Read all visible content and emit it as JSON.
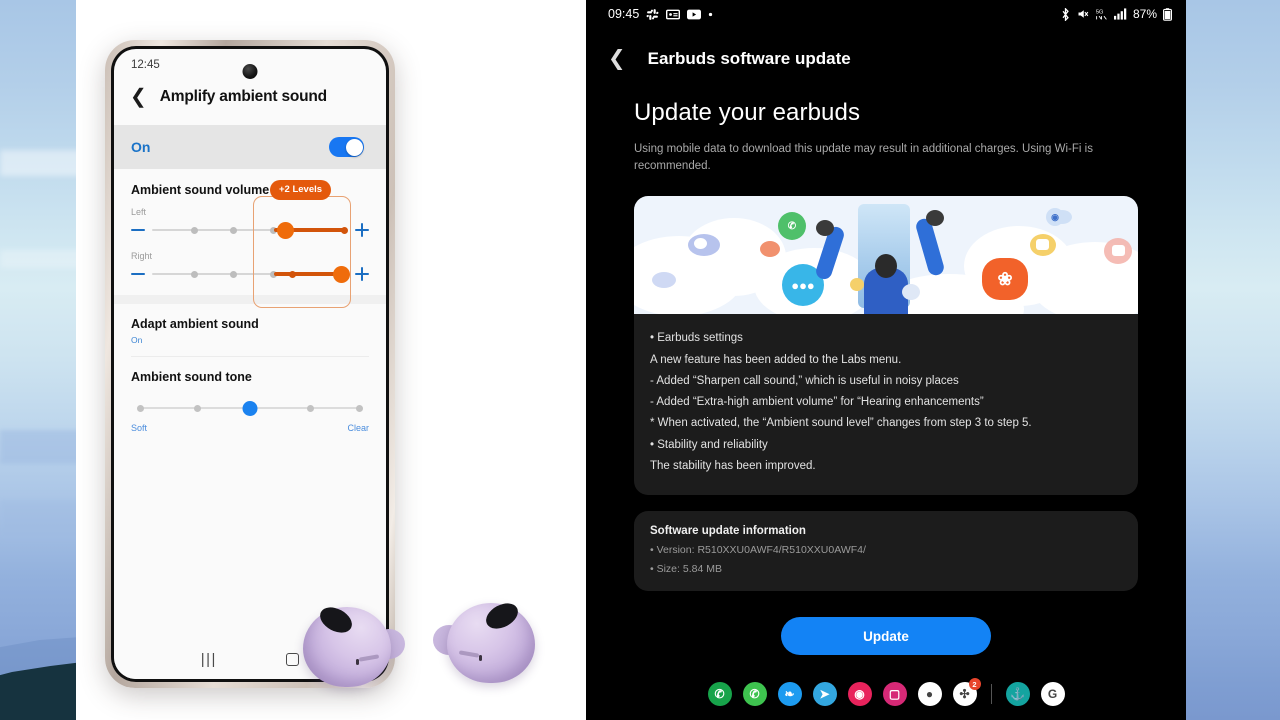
{
  "phone": {
    "status_time": "12:45",
    "back_icon": "chevron-left-icon",
    "title": "Amplify ambient sound",
    "toggle": {
      "label": "On",
      "state": "on"
    },
    "volume_section": {
      "title": "Ambient sound volume",
      "badge": "+2 Levels",
      "left_label": "Left",
      "right_label": "Right",
      "minus_icon": "minus-icon",
      "plus_icon": "plus-icon",
      "left_level": 4,
      "right_level": 6,
      "max_level": 6
    },
    "adapt": {
      "title": "Adapt ambient sound",
      "value": "On"
    },
    "tone": {
      "title": "Ambient sound tone",
      "min_label": "Soft",
      "max_label": "Clear",
      "level": 3,
      "max_level": 5
    },
    "navbar": {
      "recents": "|||",
      "home_icon": "home-square-icon"
    }
  },
  "right": {
    "statusbar": {
      "time": "09:45",
      "left_icons": [
        "slack-icon",
        "email-icon",
        "play-icon",
        "dot-icon"
      ],
      "right_icons": [
        "bluetooth-icon",
        "mute-icon",
        "5g-icon",
        "signal-icon"
      ],
      "battery": "87%"
    },
    "header": {
      "back_icon": "chevron-left-icon",
      "title": "Earbuds software update"
    },
    "heading": "Update your earbuds",
    "description": "Using mobile data to download this update may result in additional charges. Using Wi-Fi is recommended.",
    "illustration_name": "update-illustration",
    "release_notes": [
      "• Earbuds settings",
      "A new feature has been added to the Labs menu.",
      "- Added “Sharpen call sound,” which is useful in noisy places",
      "- Added “Extra-high ambient volume” for “Hearing enhancements”",
      "* When activated, the “Ambient sound level” changes from step 3 to step 5.",
      "• Stability and reliability",
      "The stability has been improved."
    ],
    "info": {
      "title": "Software update information",
      "version": "• Version: R510XXU0AWF4/R510XXU0AWF4/",
      "size": "• Size: 5.84 MB"
    },
    "update_button": "Update",
    "dock": [
      {
        "name": "phone-icon",
        "glyph": "✆",
        "bg": "#17a34a"
      },
      {
        "name": "whatsapp-icon",
        "glyph": "✆",
        "bg": "#3ec34f"
      },
      {
        "name": "twitter-icon",
        "glyph": "❧",
        "bg": "#1d9bf0"
      },
      {
        "name": "telegram-icon",
        "glyph": "➤",
        "bg": "#33a7e0"
      },
      {
        "name": "camera-icon",
        "glyph": "◉",
        "bg": "#e8235c"
      },
      {
        "name": "instagram-icon",
        "glyph": "▢",
        "bg": "#d62976"
      },
      {
        "name": "chrome-icon",
        "glyph": "●",
        "bg": "#ffffff"
      },
      {
        "name": "slack-icon",
        "glyph": "✣",
        "bg": "#ffffff",
        "badge": "2"
      },
      {
        "name": "dock-divider",
        "glyph": "",
        "bg": ""
      },
      {
        "name": "samsung-internet-icon",
        "glyph": "⚓",
        "bg": "#14a4a0"
      },
      {
        "name": "google-icon",
        "glyph": "G",
        "bg": "#ffffff"
      }
    ]
  },
  "colors": {
    "accent_blue": "#1383f5",
    "highlight_orange": "#e4590c",
    "toggle_blue": "#1877f2",
    "dark_bg": "#000000",
    "card_bg": "#1c1c1c"
  }
}
